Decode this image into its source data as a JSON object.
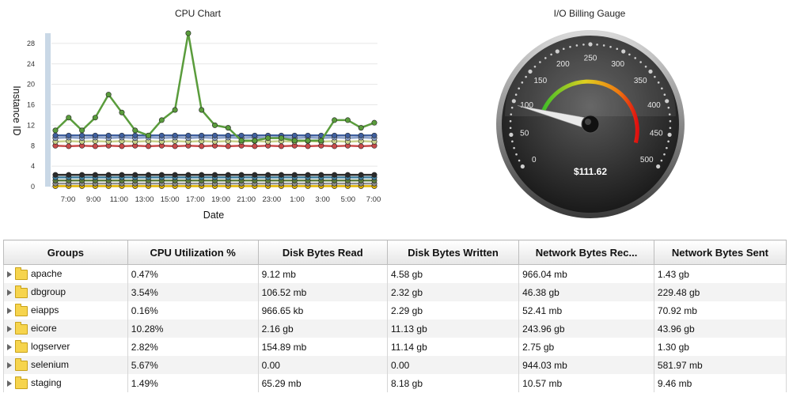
{
  "cpu_chart": {
    "title": "CPU Chart",
    "chart_data": {
      "type": "line",
      "title": "CPU Chart",
      "xlabel": "Date",
      "ylabel": "Instance ID",
      "ylim": [
        0,
        30
      ],
      "y_ticks": [
        "0",
        "4",
        "8",
        "12",
        "16",
        "20",
        "24",
        "28"
      ],
      "x_tick_labels": [
        "7:00",
        "9:00",
        "11:00",
        "13:00",
        "15:00",
        "17:00",
        "19:00",
        "21:00",
        "23:00",
        "1:00",
        "3:00",
        "5:00",
        "7:00"
      ],
      "series": [
        {
          "color": "#5a9c3c",
          "values": [
            11,
            13.5,
            11,
            13.5,
            18,
            14.5,
            11,
            10,
            13,
            15,
            30,
            15,
            12,
            11.5,
            9,
            9,
            9.5,
            9.5,
            9,
            9,
            9,
            13,
            13,
            11.5,
            12.5
          ]
        },
        {
          "color": "#3f5f9e",
          "values": [
            10,
            10,
            10,
            10,
            10,
            10,
            10,
            10,
            10,
            10,
            10,
            10,
            10,
            10,
            10,
            10,
            10,
            10,
            10,
            10,
            10,
            10,
            10,
            10,
            10
          ]
        },
        {
          "color": "#8aa0c9",
          "values": [
            9.5,
            9.6,
            9.5,
            9.6,
            9.5,
            9.6,
            9.5,
            9.6,
            9.5,
            9.6,
            9.5,
            9.6,
            9.5,
            9.6,
            9.5,
            9.6,
            9.5,
            9.6,
            9.5,
            9.6,
            9.5,
            9.6,
            9.5,
            9.6,
            9.5
          ]
        },
        {
          "color": "#c7d08a",
          "values": [
            8.8,
            8.9,
            8.8,
            8.9,
            8.8,
            8.9,
            8.8,
            8.9,
            8.8,
            8.9,
            8.8,
            8.9,
            8.8,
            8.9,
            8.8,
            8.9,
            8.8,
            8.9,
            8.8,
            8.9,
            8.8,
            8.9,
            8.8,
            8.9,
            8.8
          ]
        },
        {
          "color": "#c94b4b",
          "values": [
            8,
            7.9,
            8,
            7.9,
            8,
            7.9,
            8,
            7.9,
            8,
            7.9,
            8,
            7.9,
            8,
            7.9,
            8,
            7.9,
            8,
            7.9,
            8,
            7.9,
            8,
            7.9,
            8,
            7.9,
            8
          ]
        },
        {
          "color": "#2b2b2b",
          "values": [
            2.3,
            2.3,
            2.3,
            2.3,
            2.3,
            2.3,
            2.3,
            2.3,
            2.3,
            2.3,
            2.3,
            2.3,
            2.3,
            2.3,
            2.3,
            2.3,
            2.3,
            2.3,
            2.3,
            2.3,
            2.3,
            2.3,
            2.3,
            2.3,
            2.3
          ]
        },
        {
          "color": "#3f7f9e",
          "values": [
            1.8,
            1.8,
            1.8,
            1.8,
            1.8,
            1.8,
            1.8,
            1.8,
            1.8,
            1.8,
            1.8,
            1.8,
            1.8,
            1.8,
            1.8,
            1.8,
            1.8,
            1.8,
            1.8,
            1.8,
            1.8,
            1.8,
            1.8,
            1.8,
            1.8
          ]
        },
        {
          "color": "#5e7e3e",
          "values": [
            1.2,
            1.2,
            1.2,
            1.2,
            1.2,
            1.2,
            1.2,
            1.2,
            1.2,
            1.2,
            1.2,
            1.2,
            1.2,
            1.2,
            1.2,
            1.2,
            1.2,
            1.2,
            1.2,
            1.2,
            1.2,
            1.2,
            1.2,
            1.2,
            1.2
          ]
        },
        {
          "color": "#8f8f8f",
          "values": [
            0.6,
            0.6,
            0.6,
            0.6,
            0.6,
            0.6,
            0.6,
            0.6,
            0.6,
            0.6,
            0.6,
            0.6,
            0.6,
            0.6,
            0.6,
            0.6,
            0.6,
            0.6,
            0.6,
            0.6,
            0.6,
            0.6,
            0.6,
            0.6,
            0.6
          ]
        },
        {
          "color": "#e2b400",
          "values": [
            0.1,
            0.1,
            0.1,
            0.1,
            0.1,
            0.1,
            0.1,
            0.1,
            0.1,
            0.1,
            0.1,
            0.1,
            0.1,
            0.1,
            0.1,
            0.1,
            0.1,
            0.1,
            0.1,
            0.1,
            0.1,
            0.1,
            0.1,
            0.1,
            0.1
          ]
        }
      ]
    }
  },
  "gauge": {
    "title": "I/O Billing Gauge",
    "min": 0,
    "max": 500,
    "value": 95,
    "readout": "$111.62",
    "labels": [
      "0",
      "50",
      "100",
      "150",
      "200",
      "250",
      "300",
      "350",
      "400",
      "450",
      "500"
    ]
  },
  "table": {
    "columns": [
      "Groups",
      "CPU Utilization %",
      "Disk Bytes Read",
      "Disk Bytes Written",
      "Network Bytes Rec...",
      "Network Bytes Sent"
    ],
    "rows": [
      [
        "apache",
        "0.47%",
        "9.12 mb",
        "4.58 gb",
        "966.04 mb",
        "1.43 gb"
      ],
      [
        "dbgroup",
        "3.54%",
        "106.52 mb",
        "2.32 gb",
        "46.38 gb",
        "229.48 gb"
      ],
      [
        "eiapps",
        "0.16%",
        "966.65 kb",
        "2.29 gb",
        "52.41 mb",
        "70.92 mb"
      ],
      [
        "eicore",
        "10.28%",
        "2.16 gb",
        "11.13 gb",
        "243.96 gb",
        "43.96 gb"
      ],
      [
        "logserver",
        "2.82%",
        "154.89 mb",
        "11.14 gb",
        "2.75 gb",
        "1.30 gb"
      ],
      [
        "selenium",
        "5.67%",
        "0.00",
        "0.00",
        "944.03 mb",
        "581.97 mb"
      ],
      [
        "staging",
        "1.49%",
        "65.29 mb",
        "8.18 gb",
        "10.57 mb",
        "9.46 mb"
      ]
    ]
  }
}
